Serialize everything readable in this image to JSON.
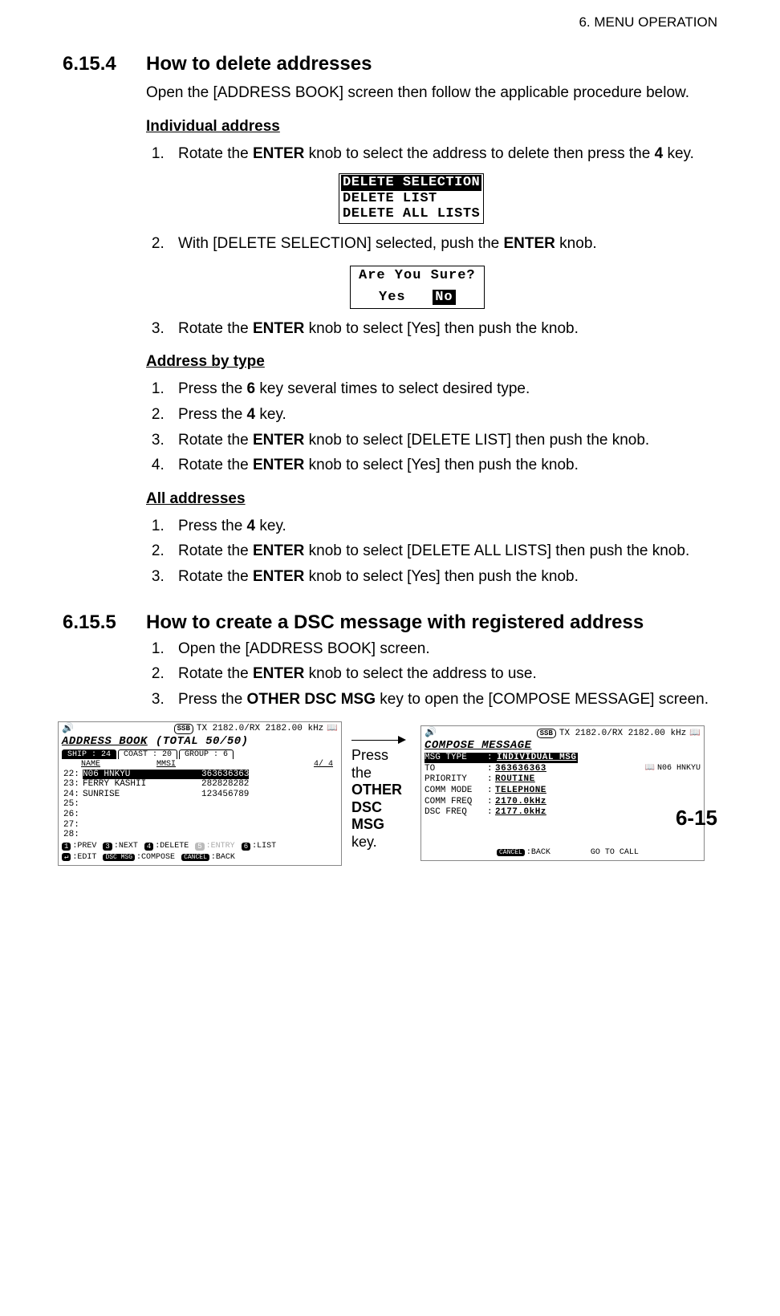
{
  "chapter": "6.  MENU OPERATION",
  "page_number": "6-15",
  "s1": {
    "num": "6.15.4",
    "title": "How to delete addresses",
    "intro": "Open the [ADDRESS BOOK] screen then follow the applicable procedure below.",
    "sub1": "Individual address",
    "step1a_pre": "Rotate the ",
    "step1a_b1": "ENTER",
    "step1a_mid": " knob to select the address to delete then press the ",
    "step1a_b2": "4",
    "step1a_post": " key.",
    "menu": {
      "sel": "DELETE SELECTION",
      "opt2": "DELETE LIST",
      "opt3": "DELETE ALL LISTS"
    },
    "step1b_pre": "With [DELETE SELECTION] selected, push the ",
    "step1b_b": "ENTER",
    "step1b_post": " knob.",
    "confirm": {
      "q": "Are You Sure?",
      "yes": "Yes",
      "no": "No"
    },
    "step1c_pre": "Rotate the ",
    "step1c_b": "ENTER",
    "step1c_post": " knob to select [Yes] then push the knob.",
    "sub2": "Address by type",
    "step2a_pre": "Press the ",
    "step2a_b": "6",
    "step2a_post": " key several times to select desired type.",
    "step2b_pre": "Press the ",
    "step2b_b": "4",
    "step2b_post": " key.",
    "step2c_pre": "Rotate the ",
    "step2c_b": "ENTER",
    "step2c_post": " knob to select [DELETE LIST] then push the knob.",
    "step2d_pre": "Rotate the ",
    "step2d_b": "ENTER",
    "step2d_post": " knob to select [Yes] then push the knob.",
    "sub3": "All addresses",
    "step3a_pre": "Press the ",
    "step3a_b": "4",
    "step3a_post": " key.",
    "step3b_pre": "Rotate the ",
    "step3b_b": "ENTER",
    "step3b_post": " knob to select [DELETE ALL LISTS] then push the knob.",
    "step3c_pre": "Rotate the ",
    "step3c_b": "ENTER",
    "step3c_post": " knob to select [Yes] then push the knob."
  },
  "s2": {
    "num": "6.15.5",
    "title": "How to create a DSC message with registered address",
    "step1": "Open the [ADDRESS BOOK] screen.",
    "step2_pre": "Rotate the ",
    "step2_b": "ENTER",
    "step2_post": " knob to select the address to use.",
    "step3_pre": "Press the ",
    "step3_b": "OTHER DSC MSG",
    "step3_post": " key to open the [COMPOSE MESSAGE] screen."
  },
  "mid_label_pre": "Press the ",
  "mid_label_b": "OTHER DSC MSG",
  "mid_label_post": " key.",
  "lcd_left": {
    "ssb": "SSB",
    "freq": "TX 2182.0/RX 2182.00 kHz",
    "title": "ADDRESS BOOK",
    "title_total": "(TOTAL  50/50)",
    "tab1": "SHIP : 24",
    "tab2": "COAST : 20",
    "tab3": "GROUP : 6",
    "hdr_name": "NAME",
    "hdr_mmsi": "MMSI",
    "hdr_page": "4/ 4",
    "rows": [
      {
        "n": "22:",
        "name": "N06 HNKYU",
        "mmsi": "363636363"
      },
      {
        "n": "23:",
        "name": "FERRY KASHII",
        "mmsi": "282828282"
      },
      {
        "n": "24:",
        "name": "SUNRISE",
        "mmsi": "123456789"
      },
      {
        "n": "25:",
        "name": "",
        "mmsi": ""
      },
      {
        "n": "26:",
        "name": "",
        "mmsi": ""
      },
      {
        "n": "27:",
        "name": "",
        "mmsi": ""
      },
      {
        "n": "28:",
        "name": "",
        "mmsi": ""
      }
    ],
    "fn": {
      "k1": "1",
      "k1l": ":PREV",
      "k3": "3",
      "k3l": ":NEXT",
      "k4": "4",
      "k4l": ":DELETE",
      "k5": "5",
      "k5l": ":ENTRY",
      "k6": "6",
      "k6l": ":LIST",
      "ke": "↵",
      "kel": ":EDIT",
      "kd": "DSC MSG",
      "kdl": ":COMPOSE",
      "kc": "CANCEL",
      "kcl": ":BACK"
    }
  },
  "lcd_right": {
    "ssb": "SSB",
    "freq": "TX 2182.0/RX 2182.00 kHz",
    "title": "COMPOSE MESSAGE",
    "rows": [
      {
        "lbl": "MSG TYPE",
        "val": "INDIVIDUAL MSG"
      },
      {
        "lbl": "TO",
        "val": "363636363",
        "note": "N06 HNKYU"
      },
      {
        "lbl": "PRIORITY",
        "val": "ROUTINE"
      },
      {
        "lbl": "COMM MODE",
        "val": "TELEPHONE"
      },
      {
        "lbl": "COMM FREQ",
        "val": " 2170.0kHz"
      },
      {
        "lbl": "DSC FREQ",
        "val": " 2177.0kHz"
      }
    ],
    "back_k": "CANCEL",
    "back_l": ":BACK",
    "go": "GO TO CALL"
  }
}
